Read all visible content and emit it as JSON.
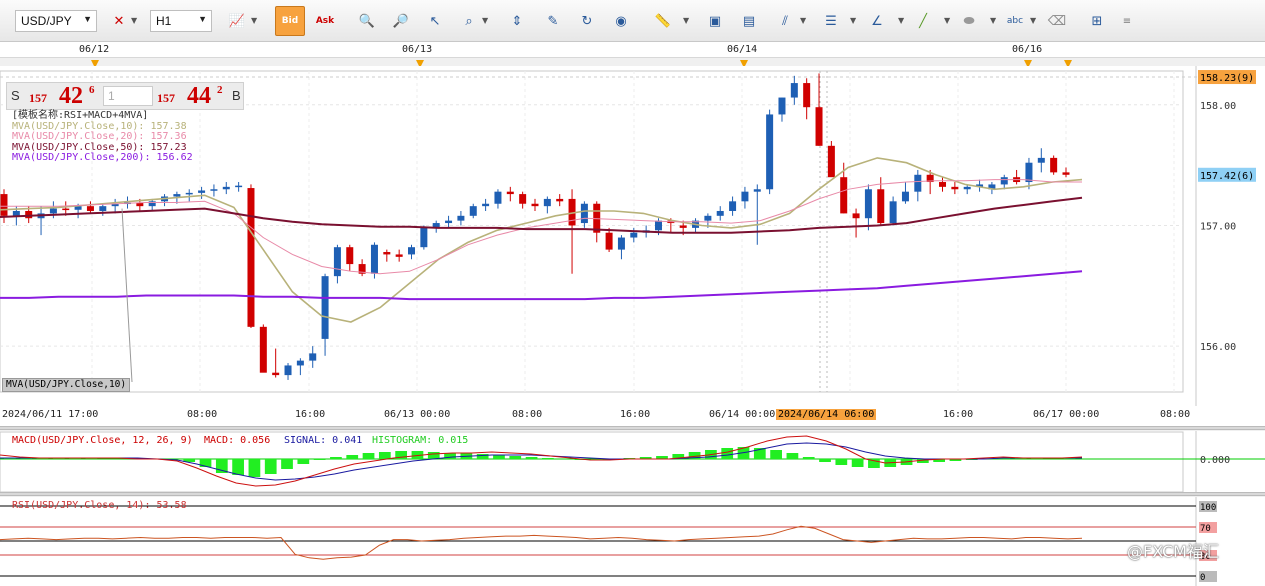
{
  "toolbar": {
    "symbol": "USD/JPY",
    "timeframe": "H1",
    "icons": [
      "chart-type-icon",
      "bid-icon",
      "ask-icon",
      "zoom-in-icon",
      "zoom-out-icon",
      "cursor-icon",
      "zoom-range-icon",
      "period-separator-icon",
      "chart-template-icon",
      "refresh-icon",
      "globe-icon",
      "ruler-icon",
      "screenshot-icon",
      "chart-window-icon",
      "fibonacci-icon",
      "line-width-icon",
      "line-tools-icon",
      "pen-icon",
      "shape-icon",
      "text-label-icon",
      "eraser-icon",
      "object-tree-icon",
      "menu-icon"
    ],
    "bid_label": "Bid",
    "ask_label": "Ask"
  },
  "date_bar": [
    "06/12",
    "06/13",
    "06/14",
    "06/16"
  ],
  "quote": {
    "sell_label": "S",
    "sell_prefix": "157",
    "sell_big": "42",
    "sell_sup": "6",
    "lot": "1",
    "buy_prefix": "157",
    "buy_big": "44",
    "buy_sup": "2",
    "buy_label": "B"
  },
  "legend": {
    "template": "[模板名称:RSI+MACD+4MVA]",
    "mva10": "MVA(USD/JPY.Close,10): 157.38",
    "mva20": "MVA(USD/JPY.Close,20): 157.36",
    "mva50": "MVA(USD/JPY.Close,50): 157.23",
    "mva200": "MVA(USD/JPY.Close,200): 156.62"
  },
  "price_axis": [
    "158.00",
    "157.00",
    "156.00"
  ],
  "price_tags": {
    "top": "158.23(9)",
    "current": "157.42(6)"
  },
  "mva_tag": "MVA(USD/JPY.Close,10)",
  "time_axis": [
    "2024/06/11 17:00",
    "08:00",
    "16:00",
    "06/13 00:00",
    "08:00",
    "16:00",
    "06/14 00:00",
    "2024/06/14 06:00",
    "16:00",
    "06/17 00:00",
    "08:00"
  ],
  "macd_label": {
    "name": "MACD(USD/JPY.Close, 12, 26, 9)",
    "macd": "MACD: 0.056",
    "signal": "SIGNAL: 0.041",
    "hist": "HISTOGRAM: 0.015"
  },
  "macd_axis": "0.000",
  "rsi_label": "RSI(USD/JPY.Close, 14): 53.58",
  "rsi_axis": [
    "100",
    "70",
    "30",
    "0"
  ],
  "watermark": "@FXCM福汇",
  "colors": {
    "bull": "#1e5fb4",
    "bear": "#d00000",
    "mva10": "#b8b27a",
    "mva20": "#e88aa8",
    "mva50": "#7a1030",
    "mva200": "#8a1be0",
    "accent": "#f7a23e"
  },
  "chart_data": {
    "type": "candlestick",
    "symbol": "USD/JPY",
    "timeframe": "H1",
    "ylim": [
      155.62,
      158.28
    ],
    "candles": [
      [
        157.26,
        157.3,
        157.02,
        157.08
      ],
      [
        157.08,
        157.16,
        157.0,
        157.12
      ],
      [
        157.12,
        157.16,
        157.02,
        157.06
      ],
      [
        157.06,
        157.16,
        156.92,
        157.1
      ],
      [
        157.1,
        157.2,
        157.06,
        157.14
      ],
      [
        157.14,
        157.2,
        157.08,
        157.13
      ],
      [
        157.13,
        157.18,
        157.06,
        157.16
      ],
      [
        157.16,
        157.2,
        157.1,
        157.12
      ],
      [
        157.12,
        157.18,
        157.08,
        157.16
      ],
      [
        157.16,
        157.22,
        157.1,
        157.18
      ],
      [
        157.18,
        157.24,
        157.14,
        157.19
      ],
      [
        157.19,
        157.22,
        157.12,
        157.16
      ],
      [
        157.16,
        157.22,
        157.12,
        157.2
      ],
      [
        157.2,
        157.26,
        157.16,
        157.24
      ],
      [
        157.24,
        157.28,
        157.18,
        157.26
      ],
      [
        157.26,
        157.3,
        157.2,
        157.27
      ],
      [
        157.27,
        157.32,
        157.22,
        157.29
      ],
      [
        157.29,
        157.34,
        157.24,
        157.3
      ],
      [
        157.3,
        157.36,
        157.26,
        157.32
      ],
      [
        157.32,
        157.36,
        157.28,
        157.33
      ],
      [
        157.31,
        157.34,
        156.15,
        156.16
      ],
      [
        156.16,
        156.18,
        155.86,
        155.78
      ],
      [
        155.78,
        155.98,
        155.74,
        155.76
      ],
      [
        155.76,
        155.86,
        155.72,
        155.84
      ],
      [
        155.84,
        155.9,
        155.76,
        155.88
      ],
      [
        155.88,
        156.0,
        155.82,
        155.94
      ],
      [
        156.06,
        156.6,
        155.92,
        156.58
      ],
      [
        156.58,
        156.84,
        156.52,
        156.82
      ],
      [
        156.82,
        156.84,
        156.62,
        156.68
      ],
      [
        156.68,
        156.72,
        156.58,
        156.6
      ],
      [
        156.6,
        156.86,
        156.56,
        156.84
      ],
      [
        156.78,
        156.8,
        156.7,
        156.76
      ],
      [
        156.76,
        156.8,
        156.7,
        156.74
      ],
      [
        156.76,
        156.84,
        156.72,
        156.82
      ],
      [
        156.82,
        157.0,
        156.8,
        156.98
      ],
      [
        156.98,
        157.04,
        156.94,
        157.02
      ],
      [
        157.02,
        157.08,
        156.98,
        157.04
      ],
      [
        157.04,
        157.12,
        157.0,
        157.08
      ],
      [
        157.08,
        157.18,
        157.06,
        157.16
      ],
      [
        157.16,
        157.22,
        157.12,
        157.18
      ],
      [
        157.18,
        157.3,
        157.14,
        157.28
      ],
      [
        157.28,
        157.32,
        157.2,
        157.26
      ],
      [
        157.26,
        157.28,
        157.14,
        157.18
      ],
      [
        157.18,
        157.22,
        157.12,
        157.16
      ],
      [
        157.16,
        157.24,
        157.1,
        157.22
      ],
      [
        157.22,
        157.26,
        157.16,
        157.2
      ],
      [
        157.22,
        157.3,
        156.6,
        157.0
      ],
      [
        157.02,
        157.2,
        156.98,
        157.18
      ],
      [
        157.18,
        157.2,
        156.86,
        156.94
      ],
      [
        156.94,
        156.98,
        156.78,
        156.8
      ],
      [
        156.8,
        156.92,
        156.72,
        156.9
      ],
      [
        156.9,
        156.98,
        156.86,
        156.94
      ],
      [
        156.94,
        157.0,
        156.9,
        156.96
      ],
      [
        156.96,
        157.06,
        156.92,
        157.04
      ],
      [
        157.04,
        157.06,
        156.94,
        157.02
      ],
      [
        157.0,
        157.04,
        156.92,
        156.98
      ],
      [
        156.98,
        157.06,
        156.94,
        157.04
      ],
      [
        157.04,
        157.1,
        156.98,
        157.08
      ],
      [
        157.08,
        157.16,
        157.04,
        157.12
      ],
      [
        157.12,
        157.24,
        157.08,
        157.2
      ],
      [
        157.2,
        157.32,
        157.14,
        157.28
      ],
      [
        157.28,
        157.34,
        156.84,
        157.3
      ],
      [
        157.3,
        157.96,
        157.26,
        157.92
      ],
      [
        157.92,
        158.06,
        157.86,
        158.06
      ],
      [
        158.06,
        158.24,
        158.0,
        158.18
      ],
      [
        158.18,
        158.22,
        157.88,
        157.98
      ],
      [
        157.98,
        158.26,
        157.66,
        157.66
      ],
      [
        157.66,
        157.7,
        157.48,
        157.4
      ],
      [
        157.4,
        157.52,
        157.1,
        157.1
      ],
      [
        157.1,
        157.14,
        156.9,
        157.06
      ],
      [
        157.06,
        157.34,
        156.96,
        157.3
      ],
      [
        157.3,
        157.4,
        157.0,
        157.02
      ],
      [
        157.02,
        157.24,
        157.0,
        157.2
      ],
      [
        157.2,
        157.36,
        157.18,
        157.28
      ],
      [
        157.28,
        157.46,
        157.2,
        157.42
      ],
      [
        157.42,
        157.46,
        157.26,
        157.36
      ],
      [
        157.36,
        157.4,
        157.28,
        157.32
      ],
      [
        157.32,
        157.36,
        157.26,
        157.3
      ],
      [
        157.3,
        157.34,
        157.26,
        157.32
      ],
      [
        157.32,
        157.38,
        157.28,
        157.34
      ],
      [
        157.3,
        157.36,
        157.26,
        157.34
      ],
      [
        157.34,
        157.42,
        157.3,
        157.4
      ],
      [
        157.4,
        157.46,
        157.34,
        157.36
      ],
      [
        157.36,
        157.56,
        157.3,
        157.52
      ],
      [
        157.52,
        157.64,
        157.44,
        157.56
      ],
      [
        157.56,
        157.58,
        157.42,
        157.44
      ],
      [
        157.44,
        157.48,
        157.4,
        157.42
      ]
    ],
    "series": [
      {
        "name": "MVA(USD/JPY.Close,10)",
        "points": [
          157.13,
          157.14,
          157.15,
          157.17,
          157.19,
          157.21,
          157.23,
          157.25,
          157.15,
          156.8,
          156.45,
          156.25,
          156.2,
          156.32,
          156.52,
          156.72,
          156.86,
          156.96,
          157.02,
          157.08,
          157.12,
          157.12,
          157.1,
          157.04,
          157.0,
          156.98,
          157.01,
          157.1,
          157.3,
          157.48,
          157.56,
          157.52,
          157.42,
          157.34,
          157.3,
          157.32,
          157.36,
          157.38
        ]
      },
      {
        "name": "MVA(USD/JPY.Close,20)",
        "points": [
          157.16,
          157.16,
          157.16,
          157.17,
          157.18,
          157.19,
          157.19,
          157.2,
          157.1,
          156.9,
          156.76,
          156.66,
          156.62,
          156.6,
          156.62,
          156.72,
          156.84,
          156.92,
          156.98,
          157.02,
          157.06,
          157.05,
          157.04,
          157.03,
          157.03,
          157.02,
          157.04,
          157.12,
          157.22,
          157.3,
          157.34,
          157.36,
          157.37,
          157.37,
          157.38,
          157.38,
          157.36,
          157.36
        ]
      },
      {
        "name": "MVA(USD/JPY.Close,50)",
        "points": [
          157.07,
          157.08,
          157.09,
          157.1,
          157.11,
          157.12,
          157.13,
          157.14,
          157.1,
          157.06,
          157.03,
          157.01,
          157.0,
          156.99,
          156.99,
          156.98,
          156.98,
          156.98,
          156.97,
          156.97,
          156.97,
          156.96,
          156.95,
          156.94,
          156.94,
          156.94,
          156.95,
          156.96,
          156.98,
          156.99,
          157.0,
          157.02,
          157.06,
          157.1,
          157.14,
          157.17,
          157.2,
          157.23
        ]
      },
      {
        "name": "MVA(USD/JPY.Close,200)",
        "points": [
          156.4,
          156.4,
          156.41,
          156.41,
          156.41,
          156.42,
          156.42,
          156.42,
          156.42,
          156.41,
          156.41,
          156.4,
          156.4,
          156.4,
          156.39,
          156.39,
          156.39,
          156.39,
          156.39,
          156.39,
          156.39,
          156.4,
          156.4,
          156.41,
          156.42,
          156.43,
          156.44,
          156.45,
          156.46,
          156.47,
          156.48,
          156.5,
          156.52,
          156.54,
          156.56,
          156.58,
          156.6,
          156.62
        ]
      }
    ],
    "macd": {
      "macd": 0.056,
      "signal": 0.041,
      "histogram": 0.015
    },
    "rsi": {
      "value": 53.58,
      "levels": [
        100,
        70,
        30,
        0
      ]
    }
  }
}
